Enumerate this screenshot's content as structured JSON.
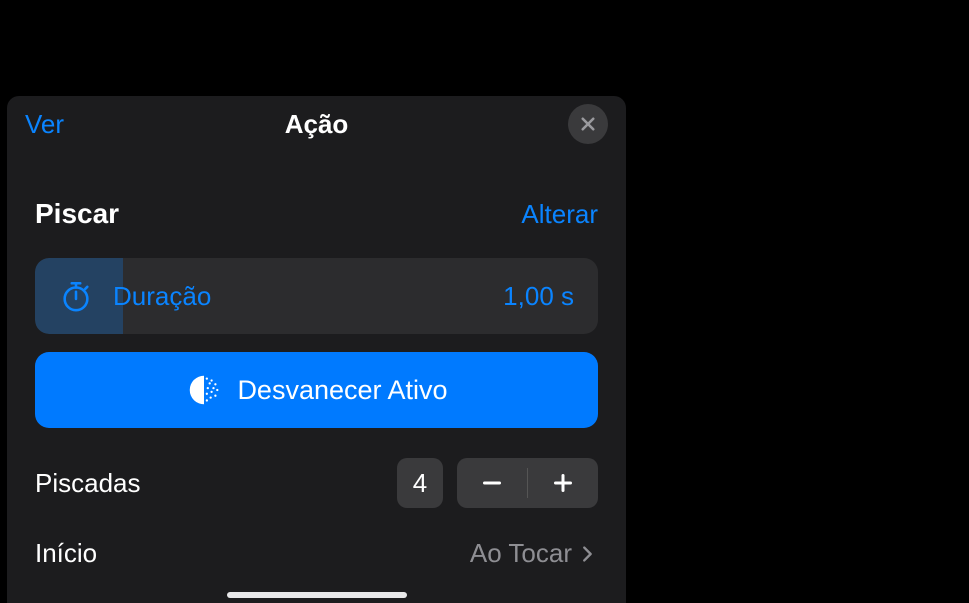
{
  "header": {
    "back_label": "Ver",
    "title": "Ação"
  },
  "section": {
    "title": "Piscar",
    "change_label": "Alterar"
  },
  "duration": {
    "label": "Duração",
    "value": "1,00 s"
  },
  "fade": {
    "label": "Desvanecer Ativo"
  },
  "blinks": {
    "label": "Piscadas",
    "value": "4"
  },
  "start": {
    "label": "Início",
    "value": "Ao Tocar"
  },
  "colors": {
    "accent": "#0a84ff",
    "panel_bg": "#1c1c1e"
  }
}
